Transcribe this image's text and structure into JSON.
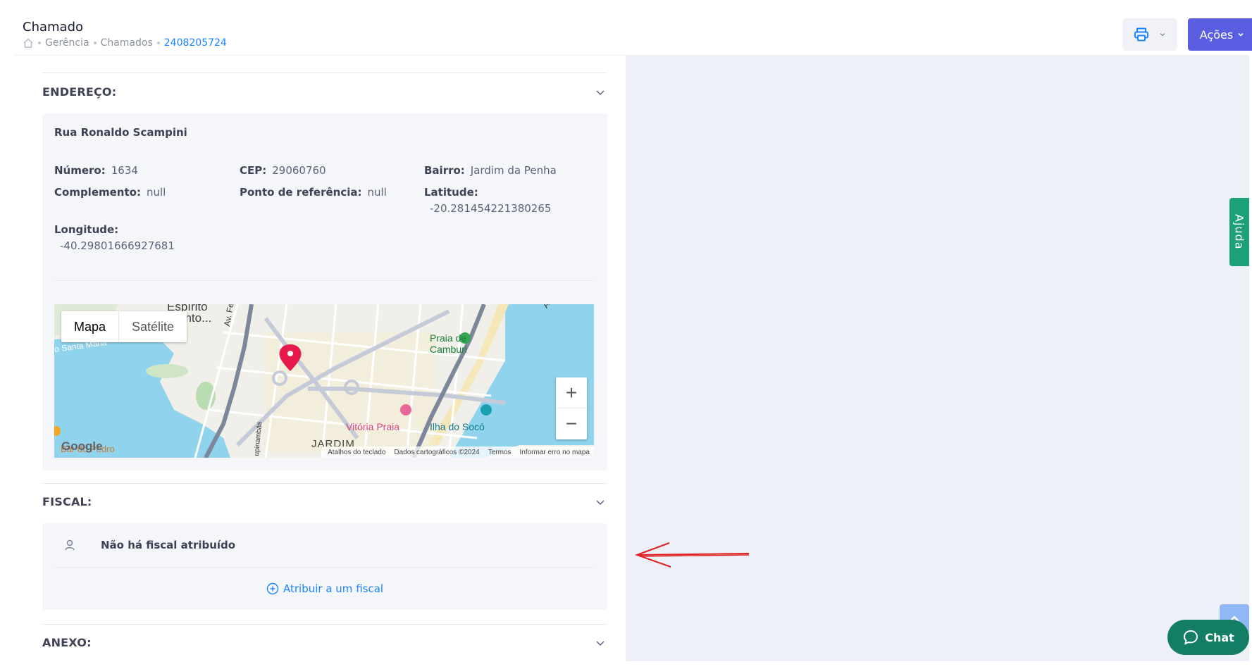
{
  "header": {
    "title": "Chamado",
    "breadcrumb": [
      "Gerência",
      "Chamados"
    ],
    "breadcrumb_current": "2408205724",
    "acoes_label": "Ações"
  },
  "endereco": {
    "title": "ENDEREÇO:",
    "street": "Rua Ronaldo Scampini",
    "numero": {
      "label": "Número:",
      "value": "1634"
    },
    "cep": {
      "label": "CEP:",
      "value": "29060760"
    },
    "bairro": {
      "label": "Bairro:",
      "value": "Jardim da Penha"
    },
    "complemento": {
      "label": "Complemento:",
      "value": "null"
    },
    "ponto_referencia": {
      "label": "Ponto de referência:",
      "value": "null"
    },
    "latitude": {
      "label": "Latitude:",
      "value": "-20.281454221380265"
    },
    "longitude": {
      "label": "Longitude:",
      "value": "-40.29801666927681"
    }
  },
  "map": {
    "type_map": "Mapa",
    "type_satellite": "Satélite",
    "labels": {
      "espirito": "Espírito",
      "santo": "anto...",
      "santa_maria": "o Santa Maria",
      "av_fernando": "Av. Fernando",
      "av_da": "Av. Da",
      "praia_de": "Praia de",
      "camburi": "Camburi",
      "vitoria_praia": "Vitória Praia",
      "ilha_do_soco": "Ilha do Socó",
      "jardim": "JARDIM",
      "bar_do_pedro": "Bar do Pedro",
      "tupinambas": "upinambás",
      "google": "Google"
    },
    "attribution": {
      "atalhos": "Atalhos do teclado",
      "dados": "Dados cartográficos ©2024",
      "termos": "Termos",
      "erro": "Informar erro no mapa"
    },
    "zoom_in": "+",
    "zoom_out": "−"
  },
  "fiscal": {
    "title": "FISCAL:",
    "empty_text": "Não há fiscal atribuído",
    "assign_label": "Atribuir a um fiscal"
  },
  "anexo": {
    "title": "ANEXO:"
  },
  "ajuda_label": "Ajuda",
  "chat_label": "Chat",
  "colors": {
    "primary": "#5a5ee0",
    "link": "#1b84ff",
    "ajuda": "#1ba07a",
    "chat": "#147e64",
    "marker": "#e8194b",
    "arrow": "#e02020"
  }
}
